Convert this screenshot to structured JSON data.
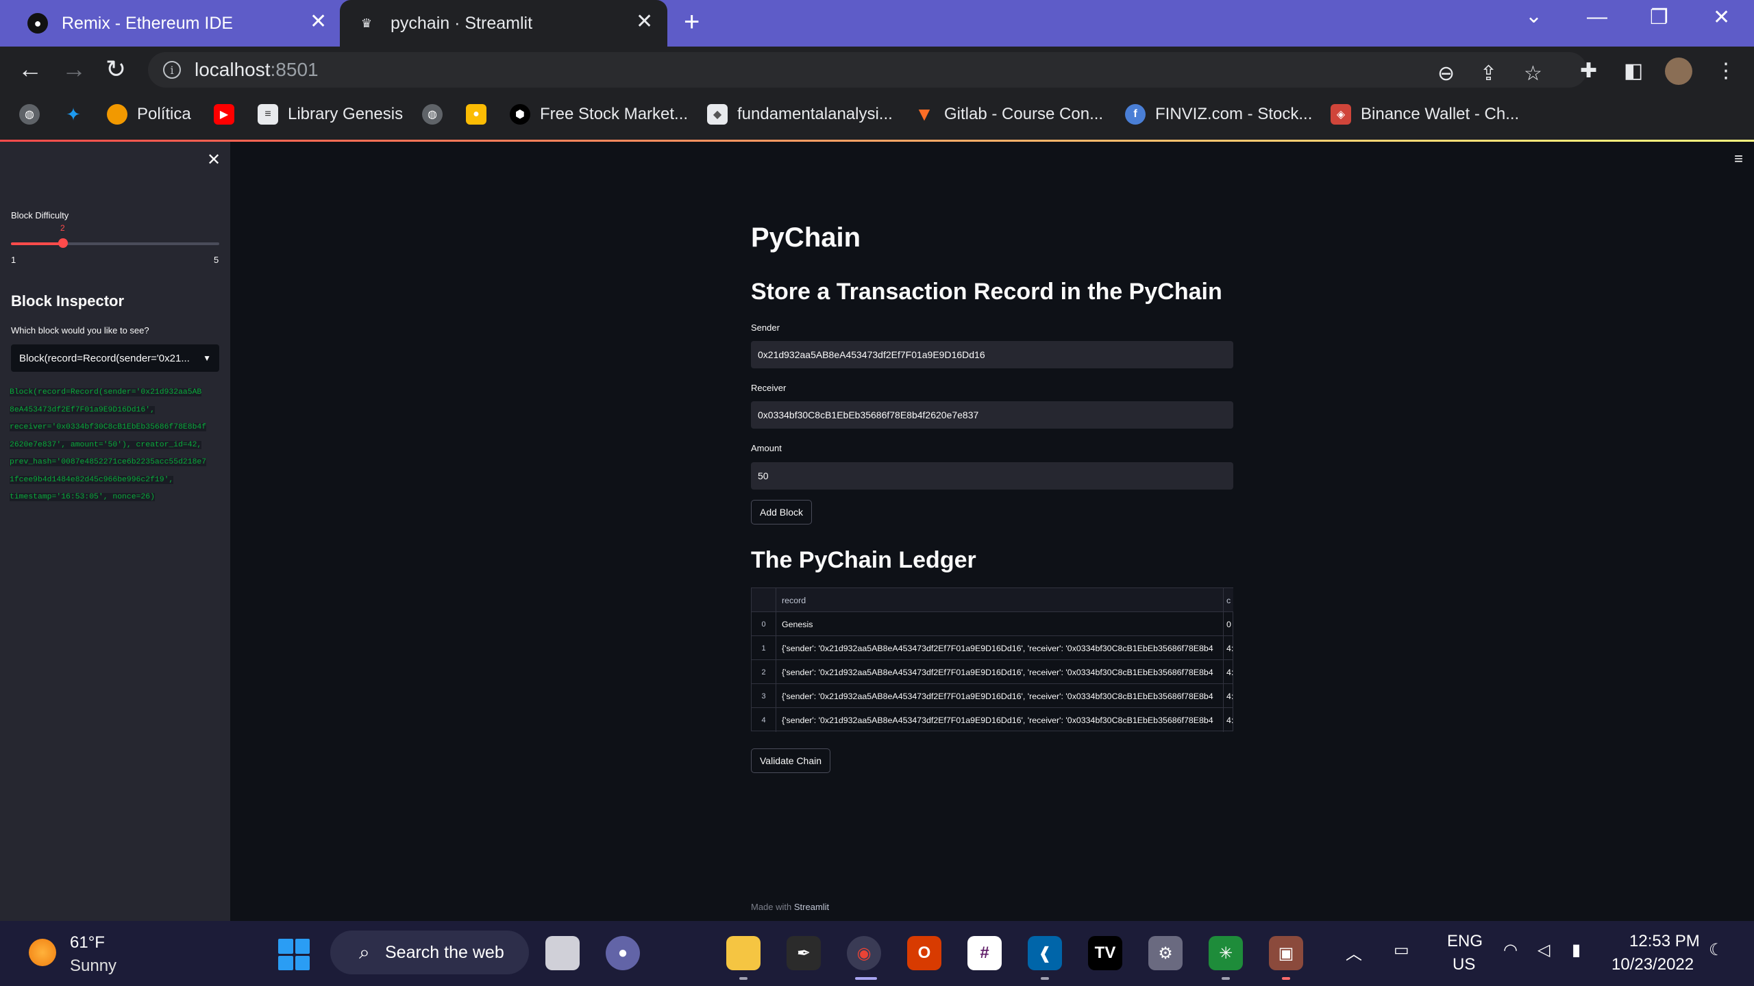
{
  "browser": {
    "tabs": [
      {
        "title": "Remix - Ethereum IDE",
        "active": false
      },
      {
        "title": "pychain · Streamlit",
        "active": true
      }
    ],
    "url_host": "localhost",
    "url_port": ":8501",
    "bookmarks": [
      {
        "label": "",
        "icon": "globe-icon"
      },
      {
        "label": "",
        "icon": "twitter-icon"
      },
      {
        "label": "Política",
        "icon": "politica-icon"
      },
      {
        "label": "",
        "icon": "youtube-icon"
      },
      {
        "label": "Library Genesis",
        "icon": "library-icon"
      },
      {
        "label": "",
        "icon": "globe-icon"
      },
      {
        "label": "",
        "icon": "keep-icon"
      },
      {
        "label": "Free Stock Market...",
        "icon": "stock-icon"
      },
      {
        "label": "fundamentalanalysi...",
        "icon": "cube-icon"
      },
      {
        "label": "Gitlab - Course Con...",
        "icon": "gitlab-icon"
      },
      {
        "label": "FINVIZ.com - Stock...",
        "icon": "finviz-icon"
      },
      {
        "label": "Binance Wallet - Ch...",
        "icon": "binance-icon"
      }
    ]
  },
  "sidebar": {
    "difficulty_label": "Block Difficulty",
    "difficulty_value": "2",
    "difficulty_min": "1",
    "difficulty_max": "5",
    "difficulty_fraction": 0.25,
    "inspector_title": "Block Inspector",
    "inspector_question": "Which block would you like to see?",
    "selected_block": "Block(record=Record(sender='0x21...",
    "block_code_lines": [
      "Block(record=Record(sender='0x21d932aa5AB",
      "8eA453473df2Ef7F01a9E9D16Dd16',",
      "receiver='0x0334bf30C8cB1EbEb35686f78E8b4f",
      "2620e7e837', amount='50'), creator_id=42,",
      "prev_hash='0087e4852271ce6b2235acc55d218e7",
      "1fcee9b4d1484e82d45c966be996c2f19',",
      "timestamp='16:53:05', nonce=26)"
    ]
  },
  "main": {
    "title": "PyChain",
    "store_heading": "Store a Transaction Record in the PyChain",
    "sender_label": "Sender",
    "sender_value": "0x21d932aa5AB8eA453473df2Ef7F01a9E9D16Dd16",
    "receiver_label": "Receiver",
    "receiver_value": "0x0334bf30C8cB1EbEb35686f78E8b4f2620e7e837",
    "amount_label": "Amount",
    "amount_value": "50",
    "add_block_label": "Add Block",
    "ledger_heading": "The PyChain Ledger",
    "table": {
      "columns": [
        "record",
        "c"
      ],
      "rows": [
        {
          "index": "0",
          "record": "Genesis",
          "creator": "0"
        },
        {
          "index": "1",
          "record": "{'sender': '0x21d932aa5AB8eA453473df2Ef7F01a9E9D16Dd16', 'receiver': '0x0334bf30C8cB1EbEb35686f78E8b4",
          "creator": "4:"
        },
        {
          "index": "2",
          "record": "{'sender': '0x21d932aa5AB8eA453473df2Ef7F01a9E9D16Dd16', 'receiver': '0x0334bf30C8cB1EbEb35686f78E8b4",
          "creator": "4:"
        },
        {
          "index": "3",
          "record": "{'sender': '0x21d932aa5AB8eA453473df2Ef7F01a9E9D16Dd16', 'receiver': '0x0334bf30C8cB1EbEb35686f78E8b4",
          "creator": "4:"
        },
        {
          "index": "4",
          "record": "{'sender': '0x21d932aa5AB8eA453473df2Ef7F01a9E9D16Dd16', 'receiver': '0x0334bf30C8cB1EbEb35686f78E8b4",
          "creator": "4:"
        }
      ]
    },
    "validate_label": "Validate Chain",
    "footer_prefix": "Made with",
    "footer_brand": "Streamlit"
  },
  "taskbar": {
    "temperature": "61°F",
    "weather": "Sunny",
    "search_text": "Search the web",
    "lang_top": "ENG",
    "lang_bottom": "US",
    "time": "12:53 PM",
    "date": "10/23/2022"
  },
  "colors": {
    "accent": "#ff4b4b",
    "tabstrip": "#5e5cc8",
    "code_green": "#09ab3b"
  }
}
